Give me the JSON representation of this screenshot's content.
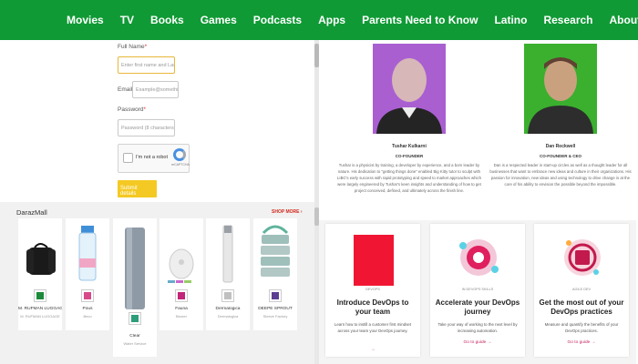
{
  "nav": {
    "items": [
      "Movies",
      "TV",
      "Books",
      "Games",
      "Podcasts",
      "Apps",
      "Parents Need to Know",
      "Latino",
      "Research",
      "About"
    ]
  },
  "form": {
    "fullname_label": "Full Name",
    "required_mark": "*",
    "fullname_placeholder": "Enter first name and Last Name",
    "email_label": "Email",
    "email_value": "Example@something.com",
    "password_label": "Password",
    "password_placeholder": "Password (8 characters minimum)",
    "captcha_label": "I'm not a robot",
    "captcha_brand": "reCAPTCHA",
    "submit_label": "Submit details"
  },
  "mall": {
    "title": "DarazMall",
    "shop_more": "SHOP MORE",
    "products": [
      {
        "name": "M. RUFMAN LUGGAGE",
        "brand": "M. RUFMAN LUGGAGE",
        "badge_color": "#1c8a3a"
      },
      {
        "name": "Pous",
        "brand": "Beco",
        "badge_color": "#d64a8a"
      },
      {
        "name": "Clear",
        "brand": "Water Service",
        "badge_color": "#2e9d7a"
      },
      {
        "name": "Fauna",
        "brand": "Beurer",
        "badge_color": "#c2257a"
      },
      {
        "name": "Dermalogica",
        "brand": "Dermalogica",
        "badge_color": "#c0c0c0"
      },
      {
        "name": "DEEPE SPROUT",
        "brand": "Sleeve Factory",
        "badge_color": "#5b3d91"
      }
    ]
  },
  "founders": [
    {
      "name": "Tushar Kulkarni",
      "role": "CO-FOUNDER",
      "bio": "Tushar is a physicist by training, a developer by experience, and a born leader by nature. His dedication to \"getting things done\" enabled Big Kitty tutor to sculpt with LIBC's early success with rapid prototyping and speed to market approaches which were largely engineered by Tushar's keen insights and understanding of how to get project conceived, defined, and ultimately across the finish line."
    },
    {
      "name": "Dan Rockwell",
      "role": "CO-FOUNDER & CEO",
      "bio": "Dan is a respected leader in start-up circles as well as a thought leader for all businesses that want to embrace new ideas and culture in their organizations. His passion for innovation, new ideas and using technology to drive change is at the core of his ability to envision the possible beyond the impossible."
    }
  ],
  "tiles": [
    {
      "tag": "DEVOPS",
      "title": "Introduce DevOps to your team",
      "desc": "Learn how to instill a customer first mindset across your team your DevOps journey.",
      "cta": "→",
      "art_color": "#f01633"
    },
    {
      "tag": "IN DEVOPS SKILLS",
      "title": "Accelerate your DevOps journey",
      "desc": "Take your way of working to the next level by increasing automation.",
      "cta": "Go to guide →",
      "art_color": "#e01f5e"
    },
    {
      "tag": "AGILE DEV",
      "title": "Get the most out of your DevOps practices",
      "desc": "Measure and quantify the benefits of your DevOps practices.",
      "cta": "Go to guide →",
      "art_color": "#c21a4d"
    }
  ]
}
